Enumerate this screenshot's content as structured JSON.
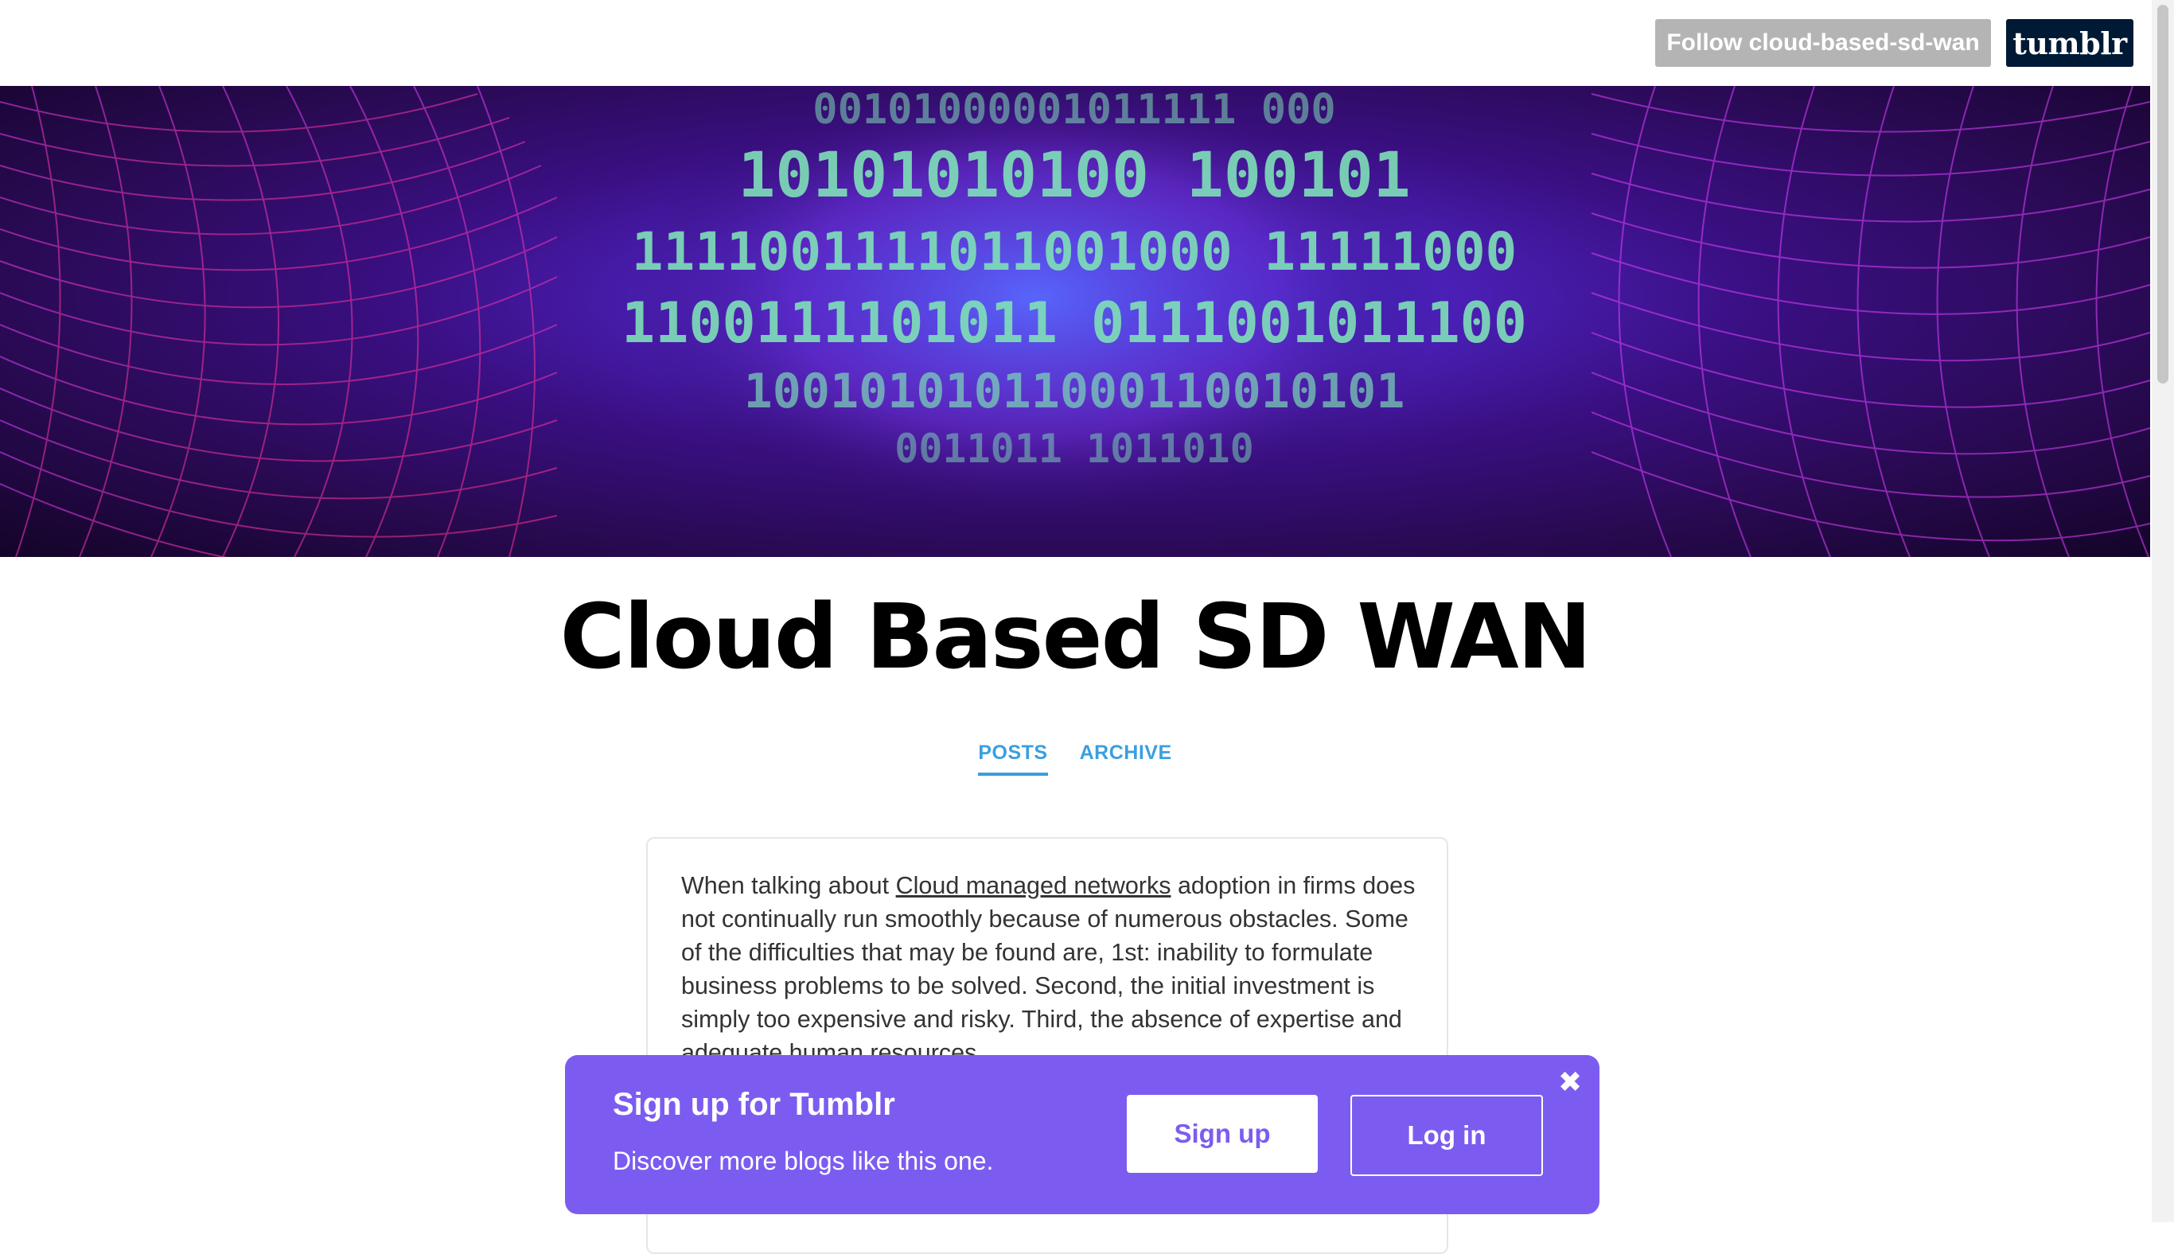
{
  "topbar": {
    "follow_label": "Follow cloud-based-sd-wan",
    "logo_text": "tumblr"
  },
  "header": {
    "banner_digits": [
      "00101000001011111 000",
      "10101010100 100101",
      "1111001111011001000 11111000",
      "1100111101011 0111001011100",
      "10010101011000110010101",
      "0011011 1011010"
    ]
  },
  "blog": {
    "title": "Cloud Based SD WAN",
    "tabs": [
      {
        "label": "POSTS",
        "active": true
      },
      {
        "label": "ARCHIVE",
        "active": false
      }
    ]
  },
  "post": {
    "text_before": "When talking about ",
    "link_text": "Cloud managed networks",
    "text_after": " adoption in firms does not continually run smoothly because of numerous obstacles. Some of the difficulties that may be found are, 1st: inability to formulate business problems to be solved. Second, the initial investment is simply too expensive and risky. Third, the absence of expertise and adequate human resources."
  },
  "signup_banner": {
    "title": "Sign up for Tumblr",
    "subtitle": "Discover more blogs like this one.",
    "signup_label": "Sign up",
    "login_label": "Log in",
    "close_glyph": "✖"
  },
  "colors": {
    "accent": "#3a9fe0",
    "signup_bg": "#7c5cf0",
    "logo_bg": "#001935",
    "follow_bg": "#b4b4b4"
  }
}
